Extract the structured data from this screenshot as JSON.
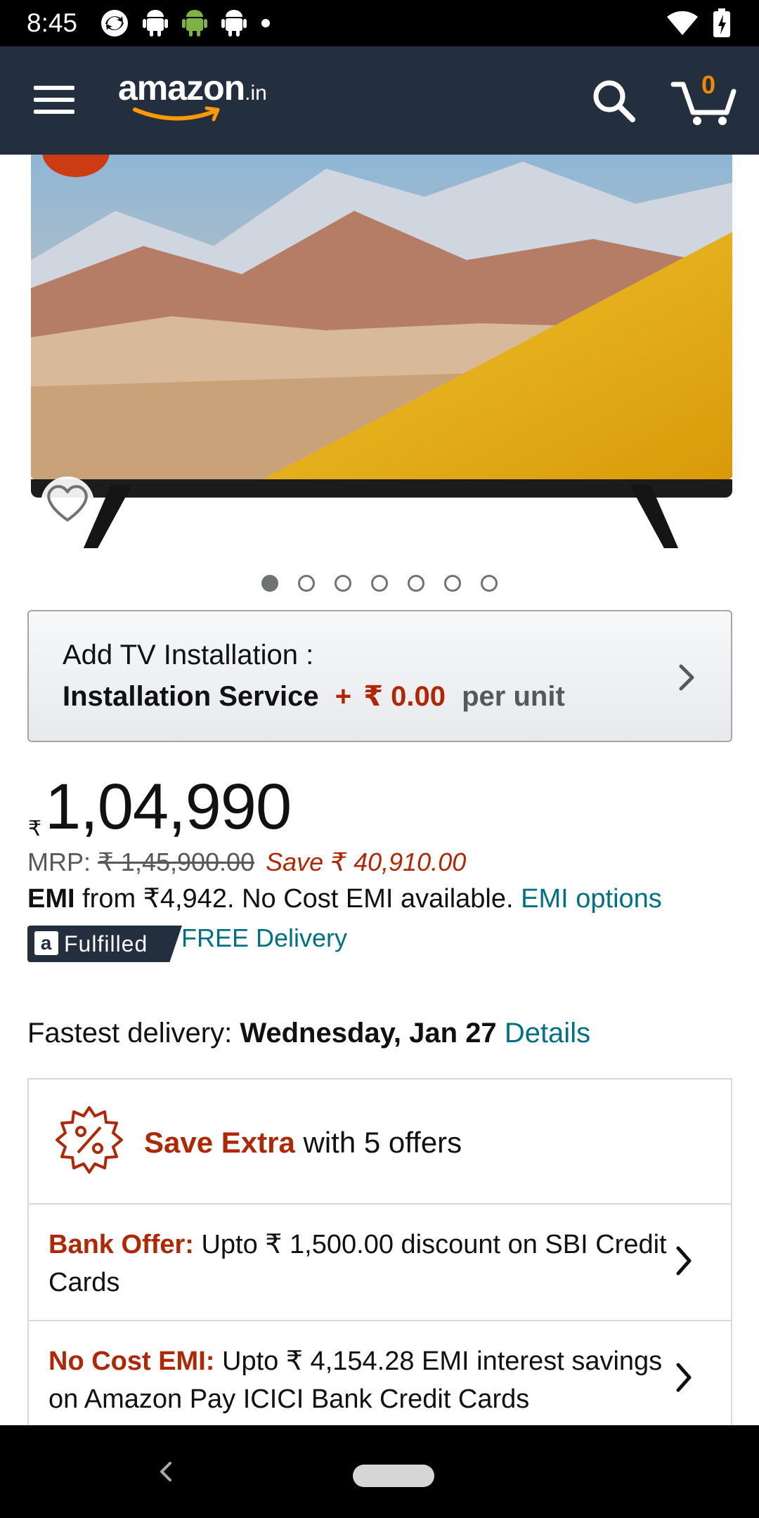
{
  "status_bar": {
    "time": "8:45",
    "icons": [
      "sync-icon",
      "android-icon",
      "android-green-icon",
      "android-icon",
      "dot-icon",
      "wifi-icon",
      "battery-icon"
    ]
  },
  "header": {
    "logo_word": "amazon",
    "logo_tld": ".in",
    "cart_count": "0"
  },
  "gallery": {
    "image_count": 7,
    "active_index": 0
  },
  "installation": {
    "title": "Add TV Installation :",
    "service": "Installation Service",
    "plus": "+",
    "price": "₹ 0.00",
    "unit": "per unit"
  },
  "price": {
    "currency_symbol": "₹",
    "amount": "1,04,990",
    "mrp_label": "MRP:",
    "mrp_value": "₹ 1,45,900.00",
    "save_text": "Save ₹ 40,910.00",
    "emi_bold": "EMI",
    "emi_text": " from ₹4,942. No Cost EMI available. ",
    "emi_link": "EMI options",
    "fulfilled_label": "Fulfilled",
    "fulfilled_logo": "a",
    "free_delivery": "FREE Delivery"
  },
  "delivery": {
    "label": "Fastest delivery: ",
    "date": "Wednesday, Jan 27",
    "details_link": "Details"
  },
  "offers": {
    "head_red": "Save Extra",
    "head_text": " with 5 offers",
    "items": [
      {
        "label": "Bank Offer:",
        "text": " Upto ₹ 1,500.00 discount on SBI Credit Cards"
      },
      {
        "label": "No Cost EMI:",
        "text": " Upto ₹ 4,154.28 EMI interest savings on Amazon Pay ICICI Bank Credit Cards"
      }
    ]
  },
  "colors": {
    "header_bg": "#232f3e",
    "price_red": "#b12704",
    "link_teal": "#007185",
    "cart_orange": "#f08804"
  }
}
